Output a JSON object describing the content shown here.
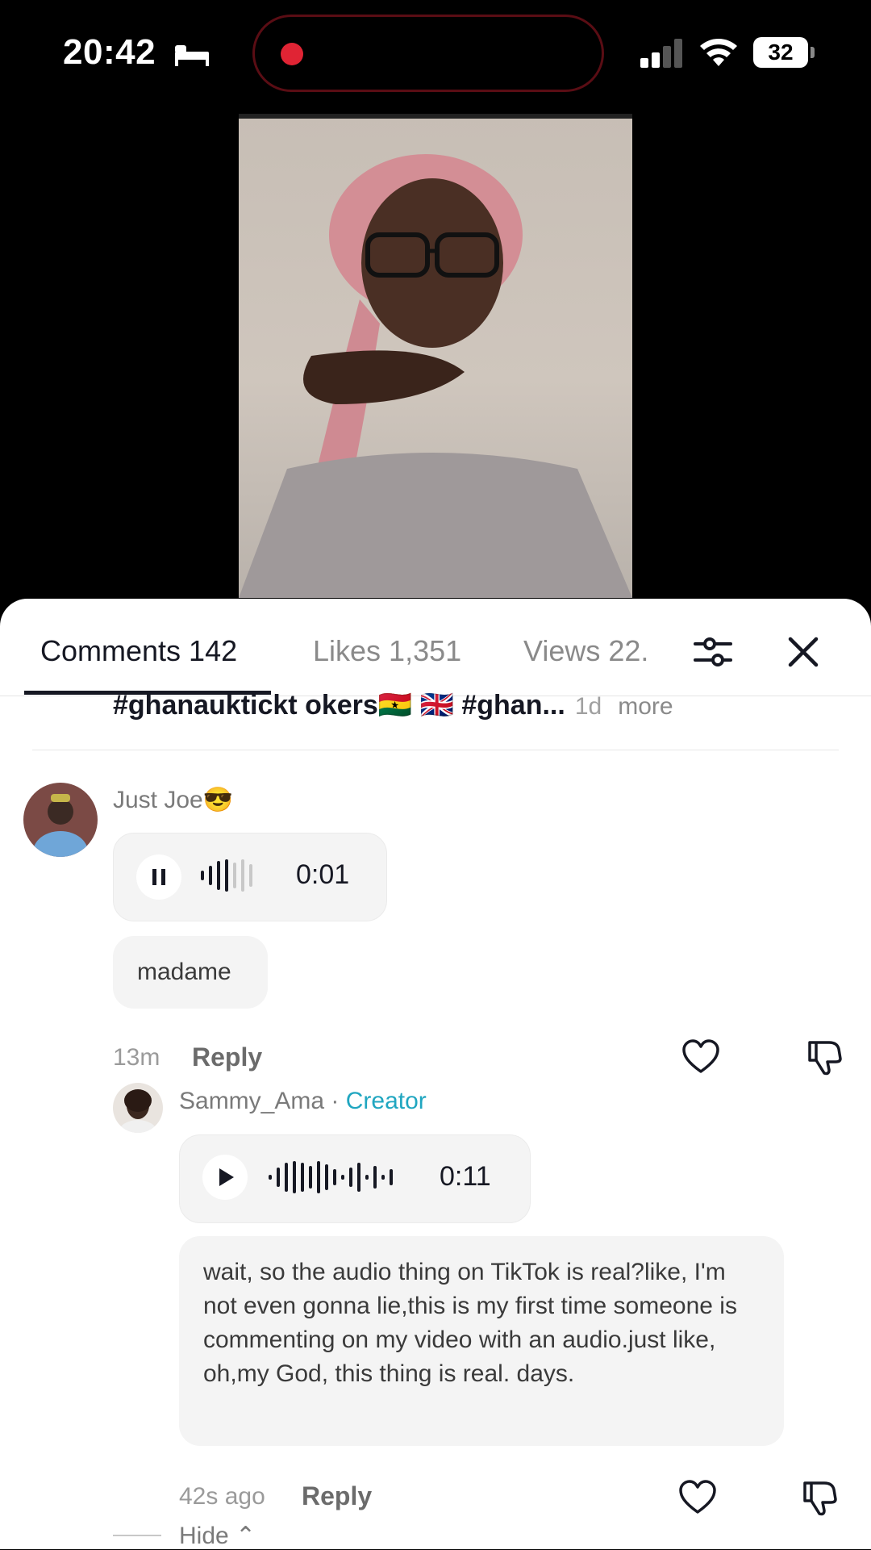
{
  "status": {
    "time": "20:42",
    "battery": "32"
  },
  "tabs": {
    "comments": "Comments 142",
    "likes": "Likes 1,351",
    "views": "Views 22."
  },
  "caption": {
    "text": "#ghanauktickt okers🇬🇭 🇬🇧 #ghan...",
    "age": "1d",
    "more": "more"
  },
  "comment1": {
    "user": "Just Joe😎",
    "audio_duration": "0:01",
    "text": "madame",
    "age": "13m",
    "reply": "Reply"
  },
  "comment2": {
    "user": "Sammy_Ama",
    "separator": "·",
    "badge": "Creator",
    "audio_duration": "0:11",
    "text": "wait, so the audio thing on TikTok is real?like, I'm not even gonna lie,this is my first time someone is commenting on my video with an audio.just like, oh,my God, this thing is real. days.",
    "age": "42s ago",
    "reply": "Reply"
  },
  "hide": {
    "label": "Hide ⌃"
  },
  "colors": {
    "creator": "#20a6c0",
    "record": "#e02434"
  }
}
